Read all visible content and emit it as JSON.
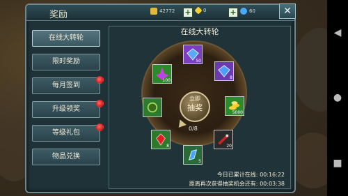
{
  "window": {
    "title": "奖励"
  },
  "currency": {
    "gold": "42772",
    "diamond": "0",
    "gem": "60"
  },
  "menu": {
    "items": [
      {
        "label": "在线大转轮"
      },
      {
        "label": "限时奖励"
      },
      {
        "label": "每月签到"
      },
      {
        "label": "升级领奖"
      },
      {
        "label": "等级礼包"
      },
      {
        "label": "物品兑换"
      }
    ]
  },
  "content": {
    "title": "在线大转轮",
    "draw_button": {
      "line1": "立即",
      "line2": "抽奖"
    },
    "progress": "0/8",
    "slots": [
      {
        "name": "blue-crystal",
        "count": "50",
        "color": "#7c3fc0"
      },
      {
        "name": "blue-crystal-large",
        "count": "8",
        "color": "#6b3bb0"
      },
      {
        "name": "gold-coins",
        "count": "5000",
        "color": "#2d8a2d"
      },
      {
        "name": "potion",
        "count": "20",
        "color": "#2a2a2a"
      },
      {
        "name": "blue-crystal-small",
        "count": "5",
        "color": "#2a6a3a"
      },
      {
        "name": "red-crystal",
        "count": "8",
        "color": "#2d7a2d"
      },
      {
        "name": "green-orb",
        "count": "",
        "color": "#2f7a2f"
      },
      {
        "name": "purple-crystal",
        "count": "100",
        "color": "#2b8a2b"
      }
    ],
    "online_time_label": "今日已累计在线:",
    "online_time_value": "00:16:22",
    "next_chance_label": "距离再次获得抽奖机会还有:",
    "next_chance_value": "00:03:38"
  }
}
